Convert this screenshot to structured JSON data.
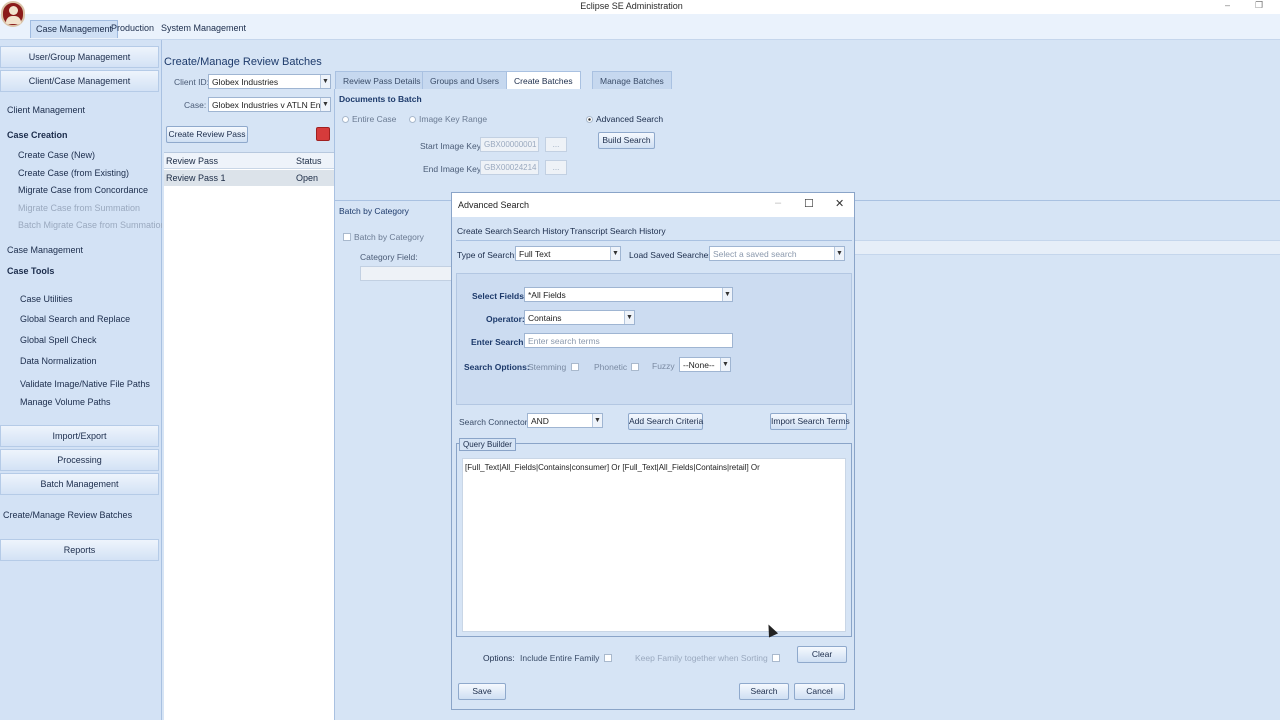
{
  "window": {
    "title": "Eclipse SE Administration",
    "minimize": "–",
    "restore": "❐"
  },
  "menu": {
    "case_management": "Case Management",
    "production": "Production",
    "system_management": "System Management"
  },
  "nav": {
    "user_group": "User/Group Management",
    "client_case": "Client/Case Management",
    "client_management": "Client Management",
    "case_creation": "Case Creation",
    "create_case_new": "Create Case (New)",
    "create_case_existing": "Create Case (from Existing)",
    "migrate_concordance": "Migrate Case from Concordance",
    "migrate_summation": "Migrate Case from Summation",
    "batch_migrate_summation": "Batch Migrate Case from Summation",
    "case_management": "Case Management",
    "case_tools": "Case Tools",
    "case_utilities": "Case Utilities",
    "global_search_replace": "Global Search and Replace",
    "global_spell_check": "Global Spell Check",
    "data_normalization": "Data Normalization",
    "validate_paths": "Validate Image/Native File Paths",
    "manage_volume_paths": "Manage Volume Paths",
    "import_export": "Import/Export",
    "processing": "Processing",
    "batch_management": "Batch Management",
    "create_manage_batches": "Create/Manage Review Batches",
    "reports": "Reports"
  },
  "page": {
    "title": "Create/Manage Review Batches",
    "client_id_label": "Client ID:",
    "client_id_value": "Globex Industries",
    "case_label": "Case:",
    "case_value": "Globex Industries v ATLN Energ",
    "create_review_pass": "Create Review Pass",
    "grid": {
      "col_review_pass": "Review Pass",
      "col_status": "Status",
      "rows": [
        {
          "name": "Review Pass 1",
          "status": "Open"
        }
      ]
    }
  },
  "tabs": {
    "review_pass_details": "Review Pass Details",
    "groups_users": "Groups and Users",
    "create_batches": "Create Batches",
    "manage_batches": "Manage Batches"
  },
  "batches": {
    "documents_to_batch": "Documents to Batch",
    "entire_case": "Entire Case",
    "image_key_range": "Image Key Range",
    "advanced_search": "Advanced Search",
    "build_search": "Build Search",
    "start_key_label": "Start Image Key:",
    "start_key_value": "GBX00000001",
    "end_key_label": "End Image Key:",
    "end_key_value": "GBX00024214",
    "ellipsis": "...",
    "batch_by_category": "Batch by Category",
    "batch_by_category_chk": "Batch by Category",
    "category_field": "Category Field:"
  },
  "dialog": {
    "title": "Advanced Search",
    "tabs": {
      "create_search": "Create Search",
      "search_history": "Search History",
      "transcript_history": "Transcript Search History"
    },
    "type_of_search_label": "Type of Search:",
    "type_of_search_value": "Full Text",
    "load_saved_label": "Load Saved Searches",
    "load_saved_placeholder": "Select a saved search",
    "select_fields_label": "Select Fields:",
    "select_fields_value": "*All Fields",
    "operator_label": "Operator:",
    "operator_value": "Contains",
    "enter_search_label": "Enter Search:",
    "enter_search_placeholder": "Enter search terms",
    "search_options_label": "Search Options:",
    "stemming": "Stemming",
    "phonetic": "Phonetic",
    "fuzzy": "Fuzzy",
    "fuzzy_value": "--None--",
    "connectors_label": "Search Connectors:",
    "connectors_value": "AND",
    "add_criteria": "Add Search Criteria",
    "import_terms": "Import Search Terms",
    "query_builder": "Query Builder",
    "query_text": "[Full_Text|All_Fields|Contains|consumer] Or  [Full_Text|All_Fields|Contains|retail] Or",
    "options_label": "Options:",
    "include_family": "Include Entire Family",
    "keep_family": "Keep Family together when Sorting",
    "clear": "Clear",
    "save": "Save",
    "search": "Search",
    "cancel": "Cancel"
  }
}
